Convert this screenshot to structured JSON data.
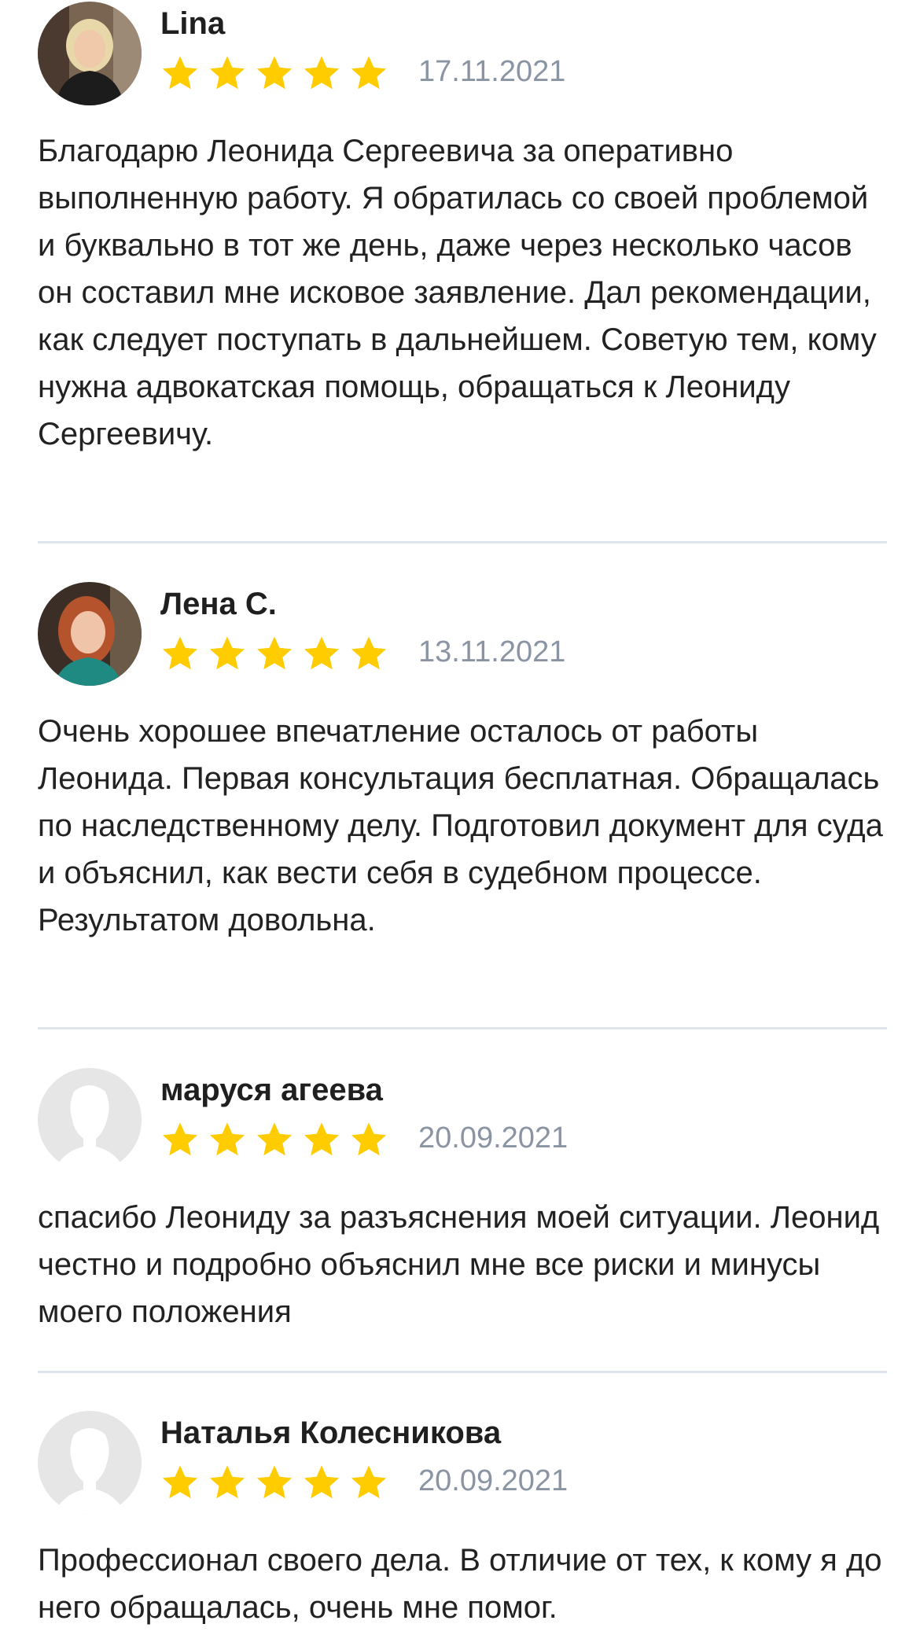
{
  "reviews": [
    {
      "name": "Lina",
      "date": "17.11.2021",
      "rating": 5,
      "avatar": "photo-blonde-woman",
      "text": "Благодарю Леонида Сергеевича за оперативно выполненную работу. Я обратилась со своей проблемой и буквально в тот же день, даже через несколько часов он составил мне исковое заявление. Дал рекомендации, как следует поступать в дальнейшем. Советую тем, кому нужна адвокатская помощь, обращаться к Леониду Сергеевичу."
    },
    {
      "name": "Лена С.",
      "date": "13.11.2021",
      "rating": 5,
      "avatar": "photo-red-haired-woman",
      "text": "Очень хорошее впечатление осталось от работы Леонида. Первая консультация бесплатная. Обращалась по наследственному делу. Подготовил документ для суда и объяснил, как вести себя в судебном процессе. Результатом довольна."
    },
    {
      "name": "маруся агеева",
      "date": "20.09.2021",
      "rating": 5,
      "avatar": "default-user-silhouette",
      "text": "спасибо Леониду за разъяснения моей ситуации. Леонид честно и подробно объяснил мне все риски и минусы моего положения"
    },
    {
      "name": "Наталья Колесникова",
      "date": "20.09.2021",
      "rating": 5,
      "avatar": "default-user-silhouette",
      "text": "Профессионал своего дела. В отличие от тех, к кому я до него обращалась, очень мне помог."
    }
  ],
  "colors": {
    "star": "#ffcc00",
    "date": "#8a94a3",
    "divider": "#dfe5ec",
    "text": "#222222"
  }
}
